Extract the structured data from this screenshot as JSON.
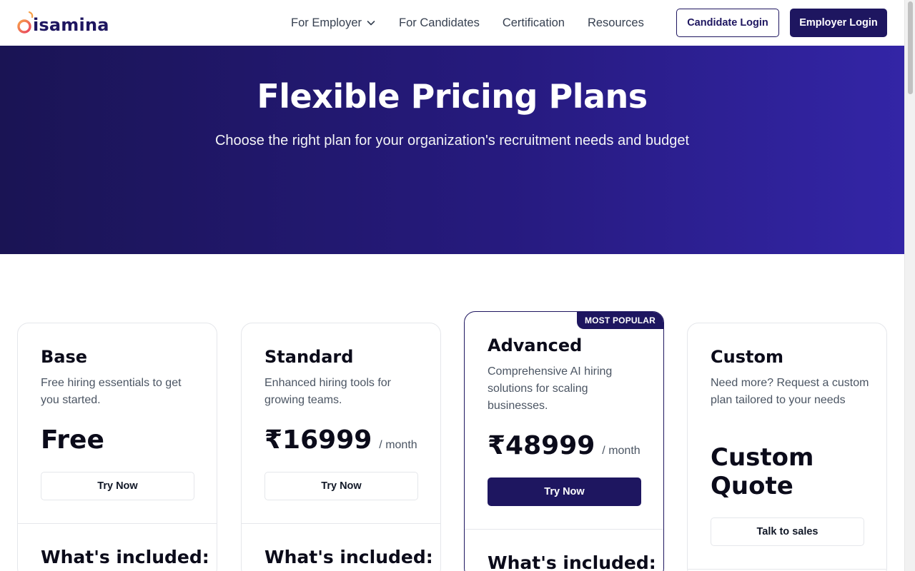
{
  "brand": {
    "name": "isamina",
    "primary_color": "#1e1660",
    "accent_color": "#f26b4f"
  },
  "nav": {
    "items": [
      {
        "label": "For Employer",
        "has_dropdown": true
      },
      {
        "label": "For Candidates"
      },
      {
        "label": "Certification"
      },
      {
        "label": "Resources"
      }
    ],
    "candidate_login": "Candidate Login",
    "employer_login": "Employer Login"
  },
  "hero": {
    "title": "Flexible Pricing Plans",
    "subtitle": "Choose the right plan for your organization's recruitment needs and budget"
  },
  "plans": [
    {
      "name": "Base",
      "description": "Free hiring essentials to get you started.",
      "price": "Free",
      "period": "",
      "cta": "Try Now",
      "included_heading": "What's included:"
    },
    {
      "name": "Standard",
      "description": "Enhanced hiring tools for growing teams.",
      "price": "₹16999",
      "period": "/ month",
      "cta": "Try Now",
      "included_heading": "What's included:"
    },
    {
      "name": "Advanced",
      "badge": "MOST POPULAR",
      "description": "Comprehensive AI hiring solutions for scaling businesses.",
      "price": "₹48999",
      "period": "/ month",
      "cta": "Try Now",
      "included_heading": "What's included:"
    },
    {
      "name": "Custom",
      "description": "Need more? Request a custom plan tailored to your needs",
      "price": "Custom Quote",
      "cta": "Talk to sales",
      "included_heading": "What's included:"
    }
  ]
}
